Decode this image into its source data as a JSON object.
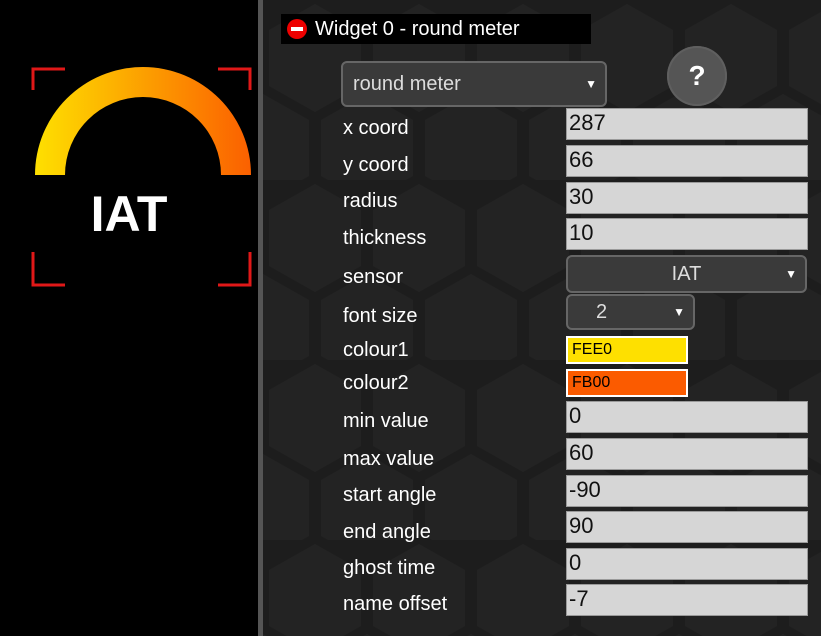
{
  "preview": {
    "gauge_label": "IAT",
    "colour_start": "#FEE000",
    "colour_end": "#FB6000",
    "bracket_color": "#E01818"
  },
  "widget": {
    "title": "Widget 0 - round meter",
    "type_select": "round meter",
    "help_label": "?"
  },
  "fields": {
    "x_coord": {
      "label": "x coord",
      "value": "287"
    },
    "y_coord": {
      "label": "y coord",
      "value": "66"
    },
    "radius": {
      "label": "radius",
      "value": "30"
    },
    "thickness": {
      "label": "thickness",
      "value": "10"
    },
    "sensor": {
      "label": "sensor",
      "value": "IAT"
    },
    "font_size": {
      "label": "font size",
      "value": "2"
    },
    "colour1": {
      "label": "colour1",
      "value": "FEE0",
      "color": "#FEE000"
    },
    "colour2": {
      "label": "colour2",
      "value": "FB00",
      "color": "#FB5B00"
    },
    "min_value": {
      "label": "min value",
      "value": "0"
    },
    "max_value": {
      "label": "max value",
      "value": "60"
    },
    "start_angle": {
      "label": "start angle",
      "value": "-90"
    },
    "end_angle": {
      "label": "end angle",
      "value": "90"
    },
    "ghost_time": {
      "label": "ghost time",
      "value": "0"
    },
    "name_offset": {
      "label": "name offset",
      "value": "-7"
    }
  }
}
